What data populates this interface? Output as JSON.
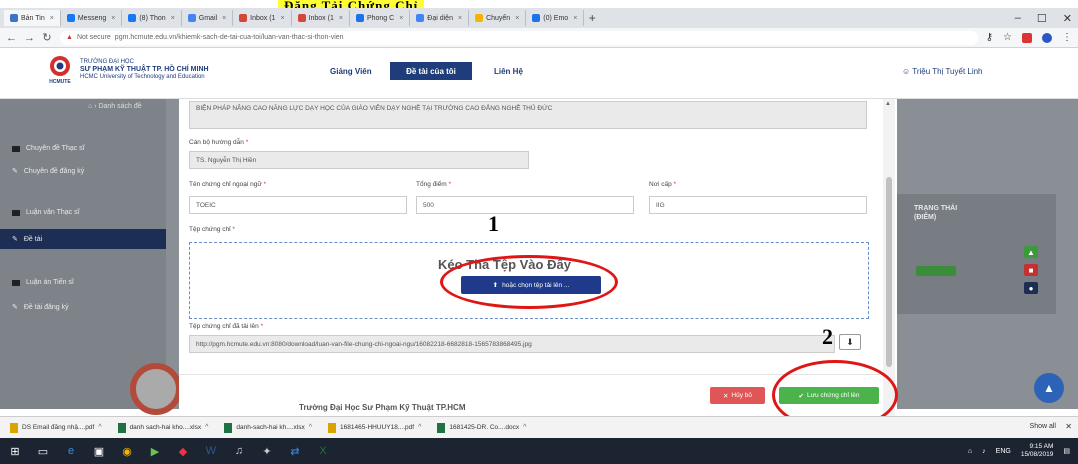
{
  "caption": {
    "highlight": "Đăng Tải Chứng Chỉ"
  },
  "browser": {
    "tabs": [
      {
        "label": "Bản Tin"
      },
      {
        "label": "Messeng"
      },
      {
        "label": "(8) Thon"
      },
      {
        "label": "Gmail"
      },
      {
        "label": "Inbox (1"
      },
      {
        "label": "Inbox (1"
      },
      {
        "label": "Phong C"
      },
      {
        "label": "Đại diện"
      },
      {
        "label": "Chuyển"
      },
      {
        "label": "(0) Emo"
      }
    ],
    "url_warning": "Not secure",
    "url": "pgm.hcmute.edu.vn/khiemk-sach-de-tai-cua-toi/luan-van-thac-si-thon-vien"
  },
  "site": {
    "uni_line1": "TRƯỜNG ĐẠI HỌC",
    "uni_line2": "SƯ PHẠM KỸ THUẬT TP. HỒ CHÍ MINH",
    "uni_line3": "HCMC University of Technology and Education",
    "logo_text": "HCMUTE",
    "nav": {
      "giang_vien": "Giảng Viên",
      "de_tai": "Đề tài của tôi",
      "lien_he": "Liên Hệ"
    },
    "user": "Triệu Thị Tuyết Linh"
  },
  "background": {
    "breadcrumb": "Danh sách đề",
    "sidebar": [
      {
        "label": "Chuyên đề Thạc sĩ"
      },
      {
        "label": "Chuyên đề đăng ký"
      },
      {
        "label": "Luận văn Thạc sĩ"
      },
      {
        "label": "Đề tài"
      },
      {
        "label": "Luận án Tiến sĩ"
      },
      {
        "label": "Đề tài đăng ký"
      }
    ],
    "status_header_1": "TRẠNG THÁI",
    "status_header_2": "(ĐIỂM)",
    "badge_green": "Đã duyệt",
    "footer_text": "Trường Đại Học Sư Phạm Kỹ Thuật TP.HCM"
  },
  "modal": {
    "topic_text": "BIỆN PHÁP NÂNG CAO NĂNG LỰC DẠY HỌC CỦA GIÁO VIÊN DẠY NGHỀ TẠI TRƯỜNG CAO ĐẲNG NGHỀ THỦ ĐỨC",
    "advisor_label": "Cán bộ hướng dẫn",
    "advisor_value": "TS. Nguyễn Thị Hiền",
    "cert_label": "Tên chứng chỉ ngoại ngữ",
    "cert_value": "TOEIC",
    "score_label": "Tổng điểm",
    "score_value": "500",
    "date_label": "Nơi cấp",
    "date_value": "IIG",
    "file_label": "Tệp chứng chỉ",
    "drop_title": "Kéo Thả Tệp Vào Đây",
    "choose_btn": "hoặc chọn tệp tải lên ...",
    "uploaded_label": "Tệp chứng chỉ đã tải lên",
    "uploaded_value": "http://pgm.hcmute.edu.vn:8080/download/luan-van-file-chung-chi-ngoai-ngu/16082218-6682818-1565783868495.jpg",
    "cancel_btn": "Hủy bỏ",
    "save_btn": "Lưu chứng chỉ lên",
    "required_mark": "*"
  },
  "annotations": {
    "one": "1",
    "two": "2"
  },
  "downloads": [
    {
      "label": "DS Email đăng nhậ....pdf",
      "color": "#d9a400"
    },
    {
      "label": "danh sach-hai kho....xlsx",
      "color": "#1e7145"
    },
    {
      "label": "danh-sach-hai kh....xlsx",
      "color": "#1e7145"
    },
    {
      "label": "1681465-HHUUY18....pdf",
      "color": "#d9a400"
    },
    {
      "label": "1681425-DR. Co....docx",
      "color": "#1e7145"
    }
  ],
  "download_show_all": "Show all",
  "taskbar": {
    "lang": "ENG",
    "time": "9:15 AM",
    "date": "15/08/2019"
  }
}
